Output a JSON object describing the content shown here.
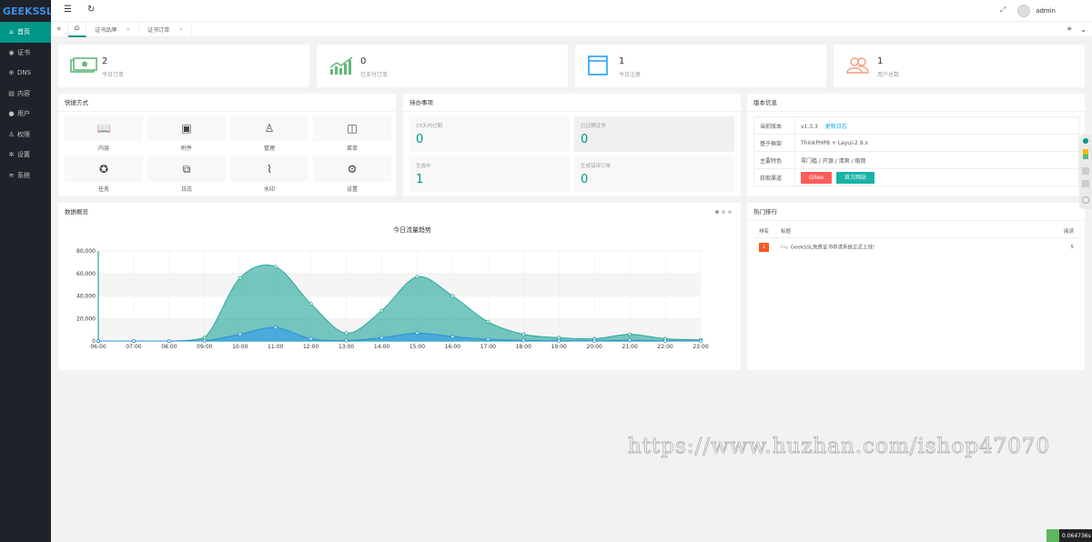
{
  "logo": "GEEKSSL",
  "sidebar": {
    "items": [
      {
        "icon": "⌂",
        "label": "首页"
      },
      {
        "icon": "◉",
        "label": "证书"
      },
      {
        "icon": "⊕",
        "label": "DNS"
      },
      {
        "icon": "▤",
        "label": "内容"
      },
      {
        "icon": "●",
        "label": "用户"
      },
      {
        "icon": "♙",
        "label": "权限"
      },
      {
        "icon": "✲",
        "label": "设置"
      },
      {
        "icon": "≋",
        "label": "系统"
      }
    ]
  },
  "topbar": {
    "user": "admin"
  },
  "tabs": [
    {
      "label": "证书品牌",
      "close": "×"
    },
    {
      "label": "证书订单",
      "close": "×"
    }
  ],
  "stats": [
    {
      "value": "2",
      "label": "今日订单",
      "icon": "money-icon",
      "color": "#5fb878"
    },
    {
      "value": "0",
      "label": "已支付订单",
      "icon": "chart-up-icon",
      "color": "#5fb878"
    },
    {
      "value": "1",
      "label": "今日注册",
      "icon": "browser-icon",
      "color": "#1e9fff"
    },
    {
      "value": "1",
      "label": "用户总数",
      "icon": "users-icon",
      "color": "#f59b7e"
    }
  ],
  "shortcuts": {
    "title": "快捷方式",
    "items": [
      {
        "icon": "📖",
        "label": "内容"
      },
      {
        "icon": "▣",
        "label": "附件"
      },
      {
        "icon": "♙",
        "label": "管理"
      },
      {
        "icon": "◫",
        "label": "菜单"
      },
      {
        "icon": "✪",
        "label": "任务"
      },
      {
        "icon": "⧉",
        "label": "日志"
      },
      {
        "icon": "⌇",
        "label": "水印"
      },
      {
        "icon": "⚙",
        "label": "设置"
      }
    ]
  },
  "todo": {
    "title": "待办事项",
    "items": [
      {
        "label": "15天内过期",
        "value": "0"
      },
      {
        "label": "已过期证书",
        "value": "0"
      },
      {
        "label": "生成中",
        "value": "1"
      },
      {
        "label": "生成错误订单",
        "value": "0"
      }
    ]
  },
  "version": {
    "title": "版本信息",
    "rows": [
      {
        "key": "当前版本",
        "value": "v1.3.3",
        "link": "更新日志"
      },
      {
        "key": "基于框架",
        "value": "ThinkPHP8 + Layui-2.9.x"
      },
      {
        "key": "主要特色",
        "value": "零门槛 / 开源 / 清爽 / 极简"
      },
      {
        "key": "获取渠道",
        "btn1": "Gitee",
        "btn2": "官方网站"
      }
    ]
  },
  "overview": {
    "title": "数据概览"
  },
  "hot": {
    "title": "热门排行",
    "headers": [
      "排名",
      "标题",
      "阅读"
    ],
    "rows": [
      {
        "rank": "1",
        "img_alt": "img",
        "title": "GeekSSL免费证书申请系统正式上线!",
        "reads": "5"
      }
    ]
  },
  "watermark": "https://www.huzhan.com/ishop47070",
  "timer": "0.064736s",
  "chart_data": {
    "type": "area",
    "title": "今日流量趋势",
    "x": [
      "06:00",
      "07:00",
      "08:00",
      "09:00",
      "10:00",
      "11:00",
      "12:00",
      "13:00",
      "14:00",
      "15:00",
      "16:00",
      "17:00",
      "18:00",
      "19:00",
      "20:00",
      "21:00",
      "22:00",
      "23:00"
    ],
    "ylim": [
      0,
      80000
    ],
    "yticks": [
      "0",
      "20,000",
      "40,000",
      "60,000",
      "80,000"
    ],
    "series": [
      {
        "values": [
          0,
          0,
          0,
          3000,
          56000,
          66000,
          33000,
          7000,
          27000,
          57000,
          40000,
          17000,
          6000,
          3000,
          2000,
          6000,
          2000,
          1000
        ],
        "color": "#2ec7c9"
      },
      {
        "values": [
          0,
          0,
          0,
          200,
          6000,
          12000,
          2000,
          500,
          3000,
          7000,
          4000,
          1500,
          500,
          300,
          200,
          600,
          200,
          100
        ],
        "color": "#3aa1e3"
      }
    ],
    "grid": true
  }
}
